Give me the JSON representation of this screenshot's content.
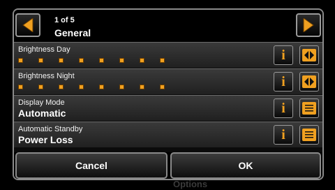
{
  "dialog": {
    "counter": "1 of 5",
    "title": "General",
    "background_text": "Options"
  },
  "rows": [
    {
      "label": "Brightness Day",
      "type": "slider",
      "level_steps": 8
    },
    {
      "label": "Brightness Night",
      "type": "slider",
      "level_steps": 8
    },
    {
      "label": "Display Mode",
      "type": "select",
      "value": "Automatic"
    },
    {
      "label": "Automatic Standby",
      "type": "select",
      "value": "Power Loss"
    }
  ],
  "buttons": {
    "cancel": "Cancel",
    "ok": "OK",
    "info_glyph": "i"
  },
  "colors": {
    "accent": "#f0a020",
    "border": "#8a8a8a",
    "background": "#000000"
  },
  "icons": [
    "arrow-left-icon",
    "arrow-right-icon",
    "info-icon",
    "left-right-arrows-icon",
    "list-icon"
  ]
}
